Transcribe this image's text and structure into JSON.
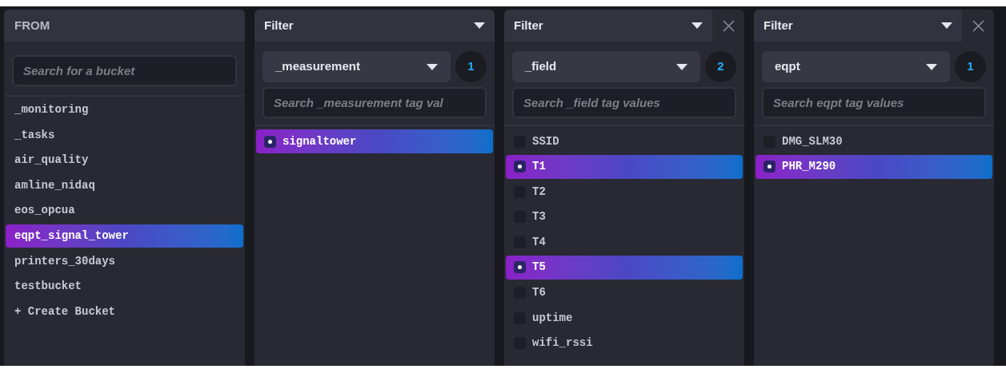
{
  "from": {
    "title": "FROM",
    "search": {
      "placeholder": "Search for a bucket"
    },
    "buckets": [
      {
        "label": "_monitoring",
        "selected": false
      },
      {
        "label": "_tasks",
        "selected": false
      },
      {
        "label": "air_quality",
        "selected": false
      },
      {
        "label": "amline_nidaq",
        "selected": false
      },
      {
        "label": "eos_opcua",
        "selected": false
      },
      {
        "label": "eqpt_signal_tower",
        "selected": true
      },
      {
        "label": "printers_30days",
        "selected": false
      },
      {
        "label": "testbucket",
        "selected": false
      }
    ],
    "create_label": "+ Create Bucket"
  },
  "filters": [
    {
      "title": "Filter",
      "closable": false,
      "key": "_measurement",
      "count": "1",
      "search": {
        "placeholder": "Search _measurement tag val"
      },
      "values": [
        {
          "label": "signaltower",
          "selected": true
        }
      ]
    },
    {
      "title": "Filter",
      "closable": true,
      "key": "_field",
      "count": "2",
      "search": {
        "placeholder": "Search _field tag values"
      },
      "values": [
        {
          "label": "SSID",
          "selected": false
        },
        {
          "label": "T1",
          "selected": true
        },
        {
          "label": "T2",
          "selected": false
        },
        {
          "label": "T3",
          "selected": false
        },
        {
          "label": "T4",
          "selected": false
        },
        {
          "label": "T5",
          "selected": true
        },
        {
          "label": "T6",
          "selected": false
        },
        {
          "label": "uptime",
          "selected": false
        },
        {
          "label": "wifi_rssi",
          "selected": false
        }
      ]
    },
    {
      "title": "Filter",
      "closable": true,
      "key": "eqpt",
      "count": "1",
      "search": {
        "placeholder": "Search eqpt tag values"
      },
      "values": [
        {
          "label": "DMG_SLM30",
          "selected": false
        },
        {
          "label": "PHR_M290",
          "selected": true
        }
      ]
    }
  ]
}
